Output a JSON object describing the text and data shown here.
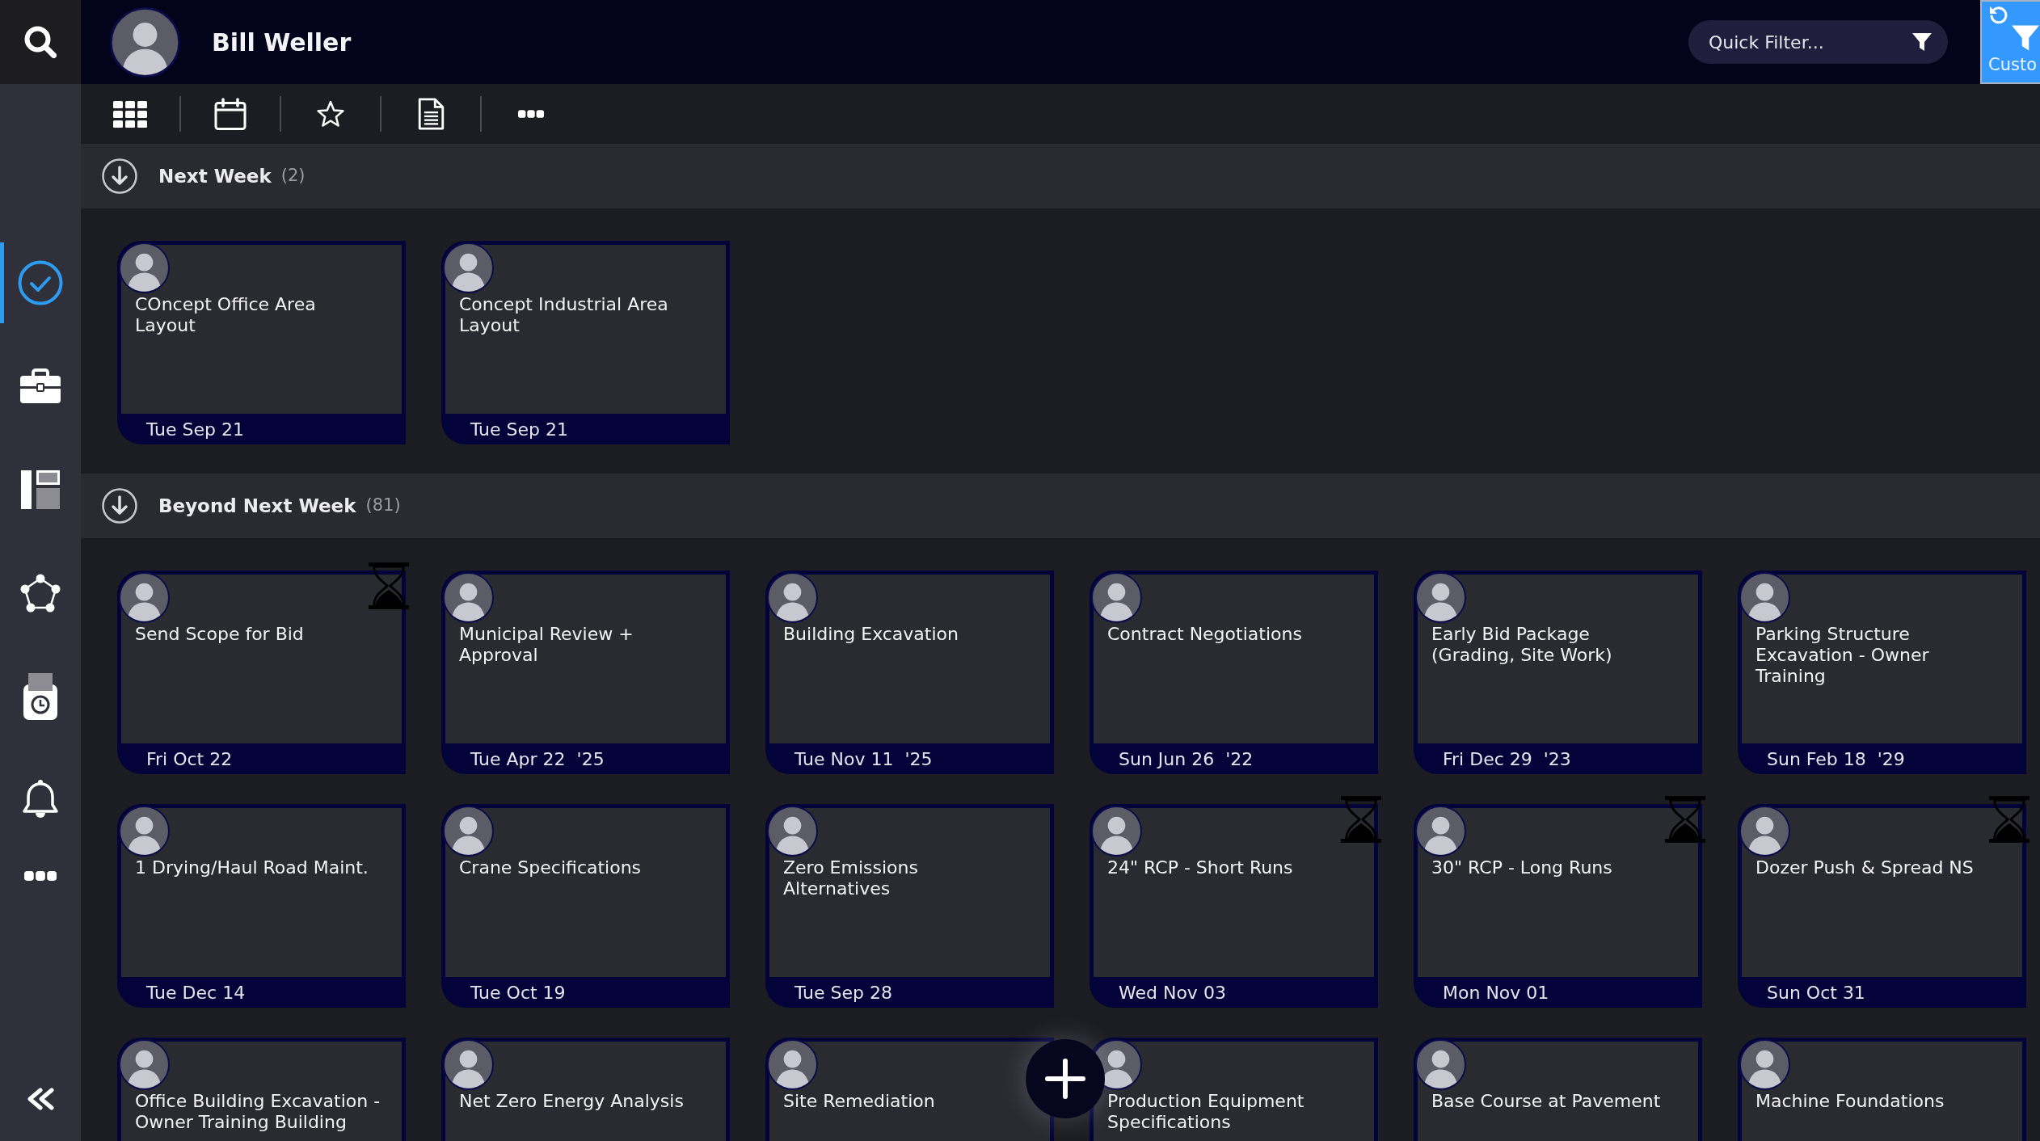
{
  "header": {
    "user_name": "Bill Weller",
    "quick_filter": {
      "placeholder": "Quick Filter..."
    },
    "custom_button": {
      "label": "Custo"
    }
  },
  "sidebar": {
    "items": [
      {
        "selected": true
      },
      {
        "selected": false
      },
      {
        "selected": false
      },
      {
        "selected": false
      },
      {
        "selected": false
      },
      {
        "selected": false
      }
    ]
  },
  "groups": [
    {
      "title": "Next Week",
      "count": "(2)",
      "cards": [
        {
          "title": "COncept Office Area Layout",
          "date": "Tue Sep 21",
          "pending": false
        },
        {
          "title": "Concept Industrial Area Layout",
          "date": "Tue Sep 21",
          "pending": false
        }
      ]
    },
    {
      "title": "Beyond Next Week",
      "count": "(81)",
      "cards": [
        {
          "title": "Send Scope for Bid",
          "date": "Fri Oct 22",
          "pending": true
        },
        {
          "title": "Municipal Review + Approval",
          "date": "Tue Apr 22  '25",
          "pending": false
        },
        {
          "title": "Building Excavation",
          "date": "Tue Nov 11  '25",
          "pending": false
        },
        {
          "title": "Contract Negotiations",
          "date": "Sun Jun 26  '22",
          "pending": false
        },
        {
          "title": "Early Bid Package (Grading, Site Work)",
          "date": "Fri Dec 29  '23",
          "pending": false
        },
        {
          "title": "Parking Structure Excavation - Owner Training",
          "date": "Sun Feb 18  '29",
          "pending": false
        },
        {
          "title": "1 Drying/Haul Road Maint.",
          "date": "Tue Dec 14",
          "pending": false
        },
        {
          "title": "Crane Specifications",
          "date": "Tue Oct 19",
          "pending": false
        },
        {
          "title": "Zero Emissions Alternatives",
          "date": "Tue Sep 28",
          "pending": false
        },
        {
          "title": "24\" RCP - Short Runs",
          "date": "Wed Nov 03",
          "pending": true
        },
        {
          "title": "30\" RCP - Long Runs",
          "date": "Mon Nov 01",
          "pending": true
        },
        {
          "title": "Dozer Push & Spread NS",
          "date": "Sun Oct 31",
          "pending": true
        },
        {
          "title": "Office Building Excavation - Owner Training Building",
          "pending": false
        },
        {
          "title": "Net Zero Energy Analysis",
          "pending": false
        },
        {
          "title": "Site Remediation",
          "pending": false
        },
        {
          "title": "Production Equipment Specifications",
          "pending": false
        },
        {
          "title": "Base Course at Pavement",
          "pending": false
        },
        {
          "title": "Machine Foundations",
          "pending": false
        }
      ]
    }
  ]
}
